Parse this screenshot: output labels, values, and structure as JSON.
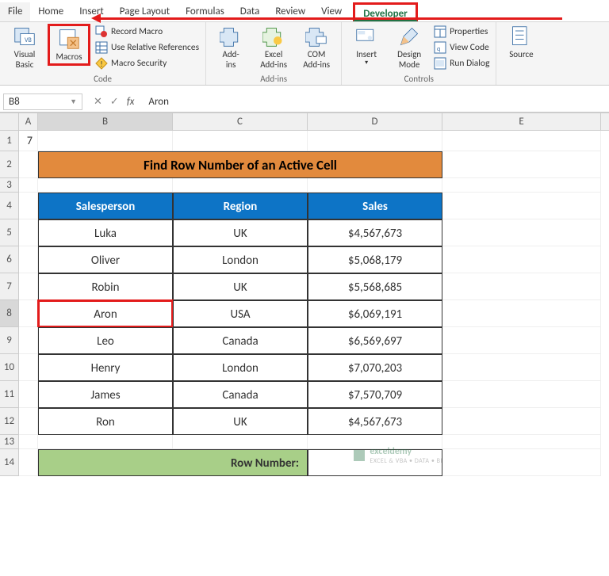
{
  "tabs": {
    "file": "File",
    "home": "Home",
    "insert": "Insert",
    "page_layout": "Page Layout",
    "formulas": "Formulas",
    "data": "Data",
    "review": "Review",
    "view": "View",
    "developer": "Developer"
  },
  "ribbon": {
    "code": {
      "label": "Code",
      "visual_basic": "Visual\nBasic",
      "macros": "Macros",
      "record_macro": "Record Macro",
      "use_relative": "Use Relative References",
      "macro_security": "Macro Security"
    },
    "addins": {
      "label": "Add-ins",
      "addins": "Add-\nins",
      "excel_addins": "Excel\nAdd-ins",
      "com_addins": "COM\nAdd-ins"
    },
    "controls": {
      "label": "Controls",
      "insert": "Insert",
      "design_mode": "Design\nMode",
      "properties": "Properties",
      "view_code": "View Code",
      "run_dialog": "Run Dialog"
    },
    "xml": {
      "source": "Source"
    }
  },
  "formula_bar": {
    "name_box": "B8",
    "value": "Aron"
  },
  "columns": {
    "A": "A",
    "B": "B",
    "C": "C",
    "D": "D",
    "E": "E"
  },
  "sheet": {
    "a1_value": "7",
    "title": "Find Row Number of an Active Cell",
    "headers": {
      "salesperson": "Salesperson",
      "region": "Region",
      "sales": "Sales"
    },
    "rows": [
      {
        "n": "5",
        "sp": "Luka",
        "rg": "UK",
        "sl": "$4,567,673"
      },
      {
        "n": "6",
        "sp": "Oliver",
        "rg": "London",
        "sl": "$5,068,179"
      },
      {
        "n": "7",
        "sp": "Robin",
        "rg": "UK",
        "sl": "$5,568,685"
      },
      {
        "n": "8",
        "sp": "Aron",
        "rg": "USA",
        "sl": "$6,069,191"
      },
      {
        "n": "9",
        "sp": "Leo",
        "rg": "Canada",
        "sl": "$6,569,697"
      },
      {
        "n": "10",
        "sp": "Henry",
        "rg": "London",
        "sl": "$7,070,203"
      },
      {
        "n": "11",
        "sp": "James",
        "rg": "Canada",
        "sl": "$7,570,709"
      },
      {
        "n": "12",
        "sp": "Ron",
        "rg": "UK",
        "sl": "$4,567,673"
      }
    ],
    "rownum_label": "Row Number:",
    "row_labels": {
      "r1": "1",
      "r2": "2",
      "r3": "3",
      "r4": "4",
      "r13": "13",
      "r14": "14"
    }
  },
  "watermark": {
    "brand": "exceldemy",
    "sub": "EXCEL & VBA • DATA • BI"
  }
}
